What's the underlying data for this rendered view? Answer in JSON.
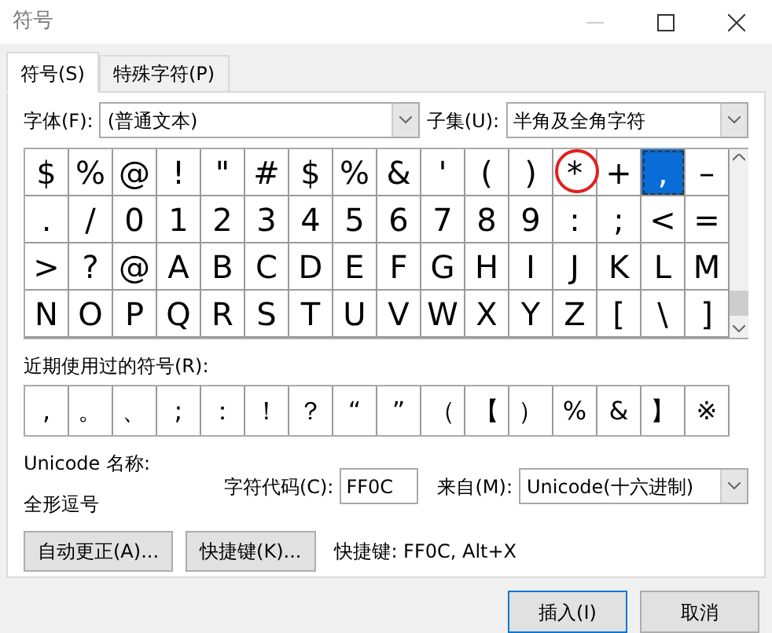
{
  "window": {
    "title": "符号"
  },
  "tabs": [
    {
      "label": "符号(S)",
      "selected": true
    },
    {
      "label": "特殊字符(P)",
      "selected": false
    }
  ],
  "font": {
    "label": "字体(F):",
    "value": "(普通文本)"
  },
  "subset": {
    "label": "子集(U):",
    "value": "半角及全角字符"
  },
  "symbol_grid": {
    "rows": [
      [
        {
          "char": "$",
          "selected": false,
          "circled": false
        },
        {
          "char": "%",
          "selected": false,
          "circled": false
        },
        {
          "char": "@",
          "selected": false,
          "circled": false
        },
        {
          "char": "!",
          "selected": false,
          "circled": false
        },
        {
          "char": "\"",
          "selected": false,
          "circled": false
        },
        {
          "char": "#",
          "selected": false,
          "circled": false
        },
        {
          "char": "$",
          "selected": false,
          "circled": false
        },
        {
          "char": "%",
          "selected": false,
          "circled": false
        },
        {
          "char": "&",
          "selected": false,
          "circled": false
        },
        {
          "char": "'",
          "selected": false,
          "circled": false
        },
        {
          "char": "(",
          "selected": false,
          "circled": false
        },
        {
          "char": ")",
          "selected": false,
          "circled": false
        },
        {
          "char": "*",
          "selected": false,
          "circled": true
        },
        {
          "char": "+",
          "selected": false,
          "circled": false
        },
        {
          "char": ",",
          "selected": true,
          "circled": false
        },
        {
          "char": "–",
          "selected": false,
          "circled": false
        }
      ],
      [
        {
          "char": ".",
          "selected": false,
          "circled": false
        },
        {
          "char": "/",
          "selected": false,
          "circled": false
        },
        {
          "char": "0",
          "selected": false,
          "circled": false
        },
        {
          "char": "1",
          "selected": false,
          "circled": false
        },
        {
          "char": "2",
          "selected": false,
          "circled": false
        },
        {
          "char": "3",
          "selected": false,
          "circled": false
        },
        {
          "char": "4",
          "selected": false,
          "circled": false
        },
        {
          "char": "5",
          "selected": false,
          "circled": false
        },
        {
          "char": "6",
          "selected": false,
          "circled": false
        },
        {
          "char": "7",
          "selected": false,
          "circled": false
        },
        {
          "char": "8",
          "selected": false,
          "circled": false
        },
        {
          "char": "9",
          "selected": false,
          "circled": false
        },
        {
          "char": ":",
          "selected": false,
          "circled": false
        },
        {
          "char": ";",
          "selected": false,
          "circled": false
        },
        {
          "char": "<",
          "selected": false,
          "circled": false
        },
        {
          "char": "=",
          "selected": false,
          "circled": false
        }
      ],
      [
        {
          "char": ">",
          "selected": false,
          "circled": false
        },
        {
          "char": "?",
          "selected": false,
          "circled": false
        },
        {
          "char": "@",
          "selected": false,
          "circled": false
        },
        {
          "char": "A",
          "selected": false,
          "circled": false
        },
        {
          "char": "B",
          "selected": false,
          "circled": false
        },
        {
          "char": "C",
          "selected": false,
          "circled": false
        },
        {
          "char": "D",
          "selected": false,
          "circled": false
        },
        {
          "char": "E",
          "selected": false,
          "circled": false
        },
        {
          "char": "F",
          "selected": false,
          "circled": false
        },
        {
          "char": "G",
          "selected": false,
          "circled": false
        },
        {
          "char": "H",
          "selected": false,
          "circled": false
        },
        {
          "char": "I",
          "selected": false,
          "circled": false
        },
        {
          "char": "J",
          "selected": false,
          "circled": false
        },
        {
          "char": "K",
          "selected": false,
          "circled": false
        },
        {
          "char": "L",
          "selected": false,
          "circled": false
        },
        {
          "char": "M",
          "selected": false,
          "circled": false
        }
      ],
      [
        {
          "char": "N",
          "selected": false,
          "circled": false
        },
        {
          "char": "O",
          "selected": false,
          "circled": false
        },
        {
          "char": "P",
          "selected": false,
          "circled": false
        },
        {
          "char": "Q",
          "selected": false,
          "circled": false
        },
        {
          "char": "R",
          "selected": false,
          "circled": false
        },
        {
          "char": "S",
          "selected": false,
          "circled": false
        },
        {
          "char": "T",
          "selected": false,
          "circled": false
        },
        {
          "char": "U",
          "selected": false,
          "circled": false
        },
        {
          "char": "V",
          "selected": false,
          "circled": false
        },
        {
          "char": "W",
          "selected": false,
          "circled": false
        },
        {
          "char": "X",
          "selected": false,
          "circled": false
        },
        {
          "char": "Y",
          "selected": false,
          "circled": false
        },
        {
          "char": "Z",
          "selected": false,
          "circled": false
        },
        {
          "char": "[",
          "selected": false,
          "circled": false
        },
        {
          "char": "\\",
          "selected": false,
          "circled": false
        },
        {
          "char": "]",
          "selected": false,
          "circled": false
        }
      ]
    ]
  },
  "recent": {
    "label": "近期使用过的符号(R):",
    "symbols": [
      ",",
      "。",
      "、",
      ";",
      "：",
      "！",
      "？",
      "“",
      "”",
      "（",
      "【",
      "）",
      "%",
      "&",
      "】",
      "※"
    ]
  },
  "unicode_name": {
    "label": "Unicode 名称:",
    "value": "全形逗号"
  },
  "char_code": {
    "label": "字符代码(C):",
    "value": "FF0C"
  },
  "from": {
    "label": "来自(M):",
    "value": "Unicode(十六进制)"
  },
  "buttons": [
    {
      "label": "自动更正(A)..."
    },
    {
      "label": "快捷键(K)..."
    }
  ],
  "shortcut": "快捷键: FF0C, Alt+X",
  "footer_buttons": [
    {
      "label": "插入(I)",
      "default": true
    },
    {
      "label": "取消",
      "default": false
    }
  ]
}
